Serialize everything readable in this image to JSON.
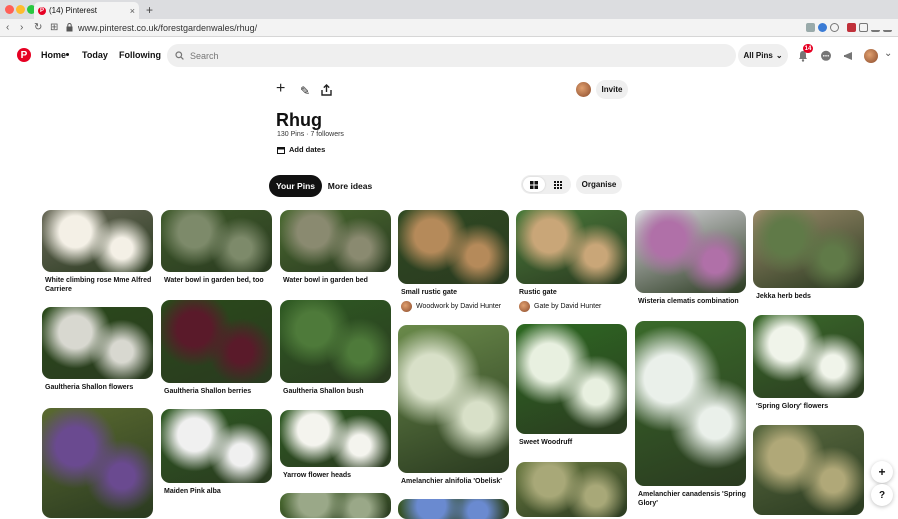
{
  "browser": {
    "tab_title": "(14) Pinterest",
    "tab_badge": "P",
    "url": "www.pinterest.co.uk/forestgardenwales/rhug/"
  },
  "header": {
    "logo": "P",
    "nav": [
      "Home",
      "Today",
      "Following"
    ],
    "search_placeholder": "Search",
    "filter_label": "All Pins",
    "notif_count": "14"
  },
  "board": {
    "invite_label": "Invite",
    "title": "Rhug",
    "meta": "130 Pins · 7 followers",
    "add_dates": "Add dates",
    "tab_active": "Your Pins",
    "tab_other": "More ideas",
    "organise_label": "Organise"
  },
  "pins": [
    {
      "title": "White climbing rose Mme Alfred Carriere",
      "by": "",
      "colors": [
        "#6b6b5a",
        "#f4f0e6"
      ]
    },
    {
      "title": "Water bowl in garden bed, too",
      "by": "",
      "colors": [
        "#3e5a2a",
        "#7d8a6a"
      ]
    },
    {
      "title": "Water bowl in garden bed",
      "by": "",
      "colors": [
        "#4a6a30",
        "#8a8a70"
      ]
    },
    {
      "title": "Small rustic gate",
      "by": "Woodwork by David Hunter",
      "colors": [
        "#2f4a22",
        "#b58a5a"
      ]
    },
    {
      "title": "Rustic gate",
      "by": "Gate by David Hunter",
      "colors": [
        "#4a7a3a",
        "#c9a678"
      ]
    },
    {
      "title": "Wisteria clematis combination",
      "by": "",
      "colors": [
        "#d8d6dc",
        "#b070a8"
      ]
    },
    {
      "title": "Jekka herb beds",
      "by": "",
      "colors": [
        "#9a8a6a",
        "#607a48"
      ]
    },
    {
      "title": "Gaultheria Shallon flowers",
      "by": "",
      "colors": [
        "#2a4a1a",
        "#d8d8d0"
      ]
    },
    {
      "title": "Gaultheria Shallon berries",
      "by": "",
      "colors": [
        "#2a4a1a",
        "#5a1a2a"
      ]
    },
    {
      "title": "Gaultheria Shallon bush",
      "by": "",
      "colors": [
        "#2e5a22",
        "#4e7a3a"
      ]
    },
    {
      "title": "Amelanchier alnifolia 'Obelisk'",
      "by": "",
      "colors": [
        "#6a8a4a",
        "#d8e0c8"
      ]
    },
    {
      "title": "Sweet Woodruff",
      "by": "",
      "colors": [
        "#2e6a22",
        "#e8f0e0"
      ]
    },
    {
      "title": "Amelanchier canadensis 'Spring Glory'",
      "by": "",
      "colors": [
        "#3a6a2a",
        "#eaf0ea"
      ]
    },
    {
      "title": "'Spring Glory' flowers",
      "by": "",
      "colors": [
        "#3a6a2a",
        "#f0f4ea"
      ]
    },
    {
      "title": "",
      "by": "",
      "colors": [
        "#5a6a30",
        "#6a4a90"
      ]
    },
    {
      "title": "Maiden Pink alba",
      "by": "",
      "colors": [
        "#2e5a22",
        "#f0f0f0"
      ]
    },
    {
      "title": "Yarrow flower heads",
      "by": "",
      "colors": [
        "#2e5a22",
        "#f4f4ee"
      ]
    },
    {
      "title": "",
      "by": "",
      "colors": [
        "#4a6a30",
        "#9aa888"
      ]
    },
    {
      "title": "",
      "by": "",
      "colors": [
        "#3a5a28",
        "#6a8ad0"
      ]
    },
    {
      "title": "",
      "by": "",
      "colors": [
        "#6a7a40",
        "#a8a878"
      ]
    },
    {
      "title": "",
      "by": "",
      "colors": [
        "#5a6a40",
        "#b0a878"
      ]
    }
  ],
  "fab": {
    "add": "+",
    "help": "?"
  }
}
